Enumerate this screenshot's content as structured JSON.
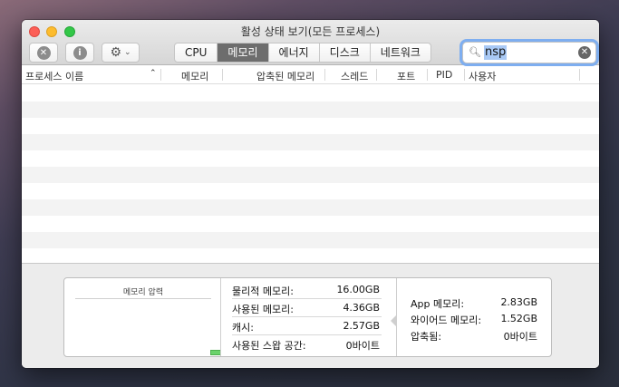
{
  "window": {
    "title": "활성 상태 보기(모든 프로세스)"
  },
  "toolbar": {
    "close_process_icon": "x-circle-icon",
    "info_icon": "info-icon",
    "gear_icon": "gear-icon",
    "tabs": [
      "CPU",
      "메모리",
      "에너지",
      "디스크",
      "네트워크"
    ],
    "active_tab": "메모리"
  },
  "search": {
    "value": "nsp"
  },
  "columns": [
    "프로세스 이름",
    "메모리",
    "압축된 메모리",
    "스레드",
    "포트",
    "PID",
    "사용자"
  ],
  "bottom": {
    "pressure_title": "메모리 압력",
    "stats": [
      {
        "label": "물리적 메모리:",
        "value": "16.00GB"
      },
      {
        "label": "사용된 메모리:",
        "value": "4.36GB"
      },
      {
        "label": "캐시:",
        "value": "2.57GB"
      },
      {
        "label": "사용된 스왑 공간:",
        "value": "0바이트"
      }
    ],
    "details": [
      {
        "label": "App 메모리:",
        "value": "2.83GB"
      },
      {
        "label": "와이어드 메모리:",
        "value": "1.52GB"
      },
      {
        "label": "압축됨:",
        "value": "0바이트"
      }
    ]
  }
}
